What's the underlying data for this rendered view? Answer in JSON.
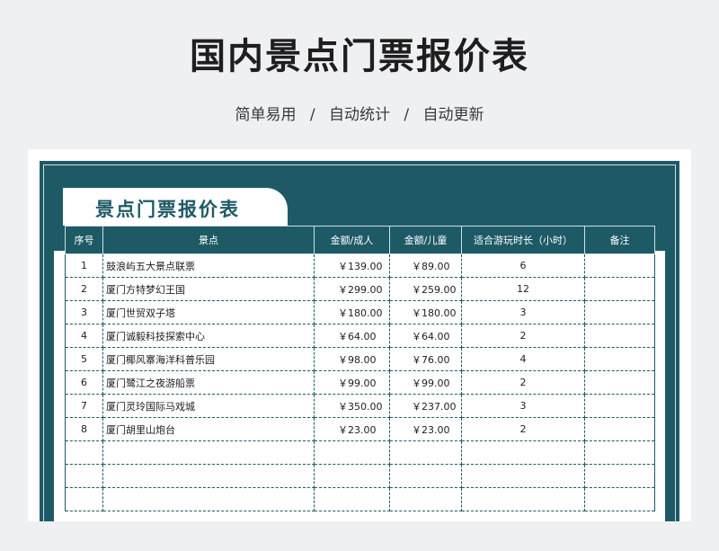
{
  "header": {
    "title": "国内景点门票报价表",
    "subtitle_items": [
      "简单易用",
      "自动统计",
      "自动更新"
    ],
    "subtitle_separator": "/"
  },
  "sheet": {
    "tab_title": "景点门票报价表",
    "accent_color": "#1e5a66",
    "columns": [
      "序号",
      "景点",
      "金额/成人",
      "金额/儿童",
      "适合游玩时长（小时）",
      "备注"
    ],
    "rows": [
      {
        "no": "1",
        "name": "鼓浪屿五大景点联票",
        "adult": "￥139.00",
        "child": "￥89.00",
        "hours": "6",
        "note": ""
      },
      {
        "no": "2",
        "name": "厦门方特梦幻王国",
        "adult": "￥299.00",
        "child": "￥259.00",
        "hours": "12",
        "note": ""
      },
      {
        "no": "3",
        "name": "厦门世贸双子塔",
        "adult": "￥180.00",
        "child": "￥180.00",
        "hours": "3",
        "note": ""
      },
      {
        "no": "4",
        "name": "厦门诚毅科技探索中心",
        "adult": "￥64.00",
        "child": "￥64.00",
        "hours": "2",
        "note": ""
      },
      {
        "no": "5",
        "name": "厦门椰风寨海洋科普乐园",
        "adult": "￥98.00",
        "child": "￥76.00",
        "hours": "4",
        "note": ""
      },
      {
        "no": "6",
        "name": "厦门鹭江之夜游船票",
        "adult": "￥99.00",
        "child": "￥99.00",
        "hours": "2",
        "note": ""
      },
      {
        "no": "7",
        "name": "厦门灵玲国际马戏城",
        "adult": "￥350.00",
        "child": "￥237.00",
        "hours": "3",
        "note": ""
      },
      {
        "no": "8",
        "name": "厦门胡里山炮台",
        "adult": "￥23.00",
        "child": "￥23.00",
        "hours": "2",
        "note": ""
      }
    ],
    "empty_rows": 3
  }
}
